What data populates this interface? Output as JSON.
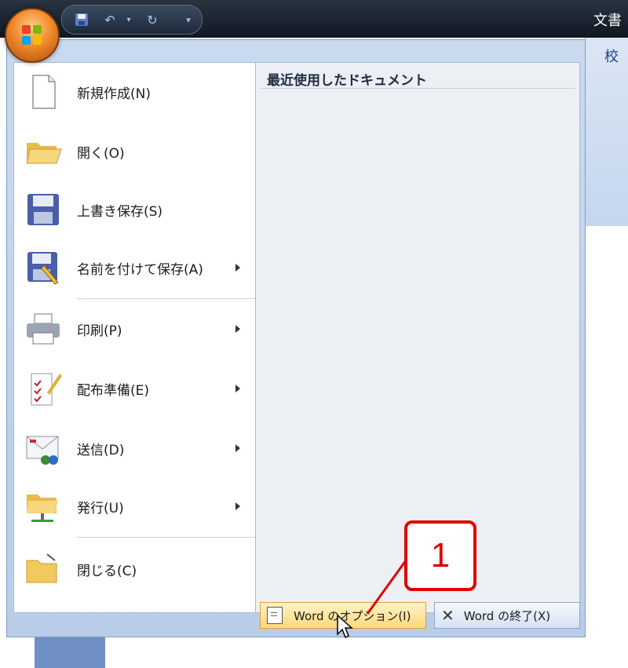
{
  "window": {
    "title_partial": "文書"
  },
  "ribbon": {
    "tab_partial": "校"
  },
  "office_menu": {
    "items": [
      {
        "label": "新規作成(N)",
        "icon": "new-document-icon",
        "has_submenu": false
      },
      {
        "label": "開く(O)",
        "icon": "open-folder-icon",
        "has_submenu": false
      },
      {
        "label": "上書き保存(S)",
        "icon": "save-disk-icon",
        "has_submenu": false
      },
      {
        "label": "名前を付けて保存(A)",
        "icon": "save-as-icon",
        "has_submenu": true
      },
      {
        "label": "印刷(P)",
        "icon": "printer-icon",
        "has_submenu": true
      },
      {
        "label": "配布準備(E)",
        "icon": "prepare-document-icon",
        "has_submenu": true
      },
      {
        "label": "送信(D)",
        "icon": "send-icon",
        "has_submenu": true
      },
      {
        "label": "発行(U)",
        "icon": "publish-icon",
        "has_submenu": true
      },
      {
        "label": "閉じる(C)",
        "icon": "close-folder-icon",
        "has_submenu": false
      }
    ],
    "recent_documents_title": "最近使用したドキュメント",
    "options_button": "Word のオプション(I)",
    "exit_button": "Word の終了(X)"
  },
  "annotation": {
    "callout_number": "1"
  },
  "colors": {
    "callout_red": "#e00000",
    "menu_blue": "#c9d9ef",
    "options_highlight": "#ffd87a"
  }
}
